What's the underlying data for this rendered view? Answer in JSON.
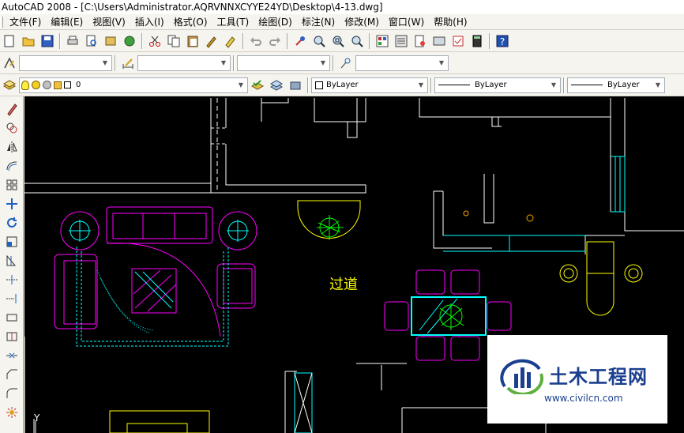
{
  "window": {
    "title": "AutoCAD 2008 - [C:\\Users\\Administrator.AQRVNNXCYYE24YD\\Desktop\\4-13.dwg]"
  },
  "menu": {
    "items": [
      "文件(F)",
      "编辑(E)",
      "视图(V)",
      "插入(I)",
      "格式(O)",
      "工具(T)",
      "绘图(D)",
      "标注(N)",
      "修改(M)",
      "窗口(W)",
      "帮助(H)"
    ]
  },
  "layers": {
    "current_layer": "0",
    "color": "ByLayer",
    "linetype": "ByLayer",
    "lineweight": "ByLayer"
  },
  "drawing": {
    "corridor_label": "过道",
    "axis_label": "Y"
  },
  "watermark": {
    "title": "土木工程网",
    "url": "www.civilcn.com"
  },
  "colors": {
    "canvas_bg": "#000000",
    "wall_lines": "#ffffff",
    "furniture": "#ff00ff",
    "cyan": "#00ffff",
    "plant": "#00ff00",
    "yellow": "#ffff00",
    "watermark_blue": "#1a3f8f"
  }
}
